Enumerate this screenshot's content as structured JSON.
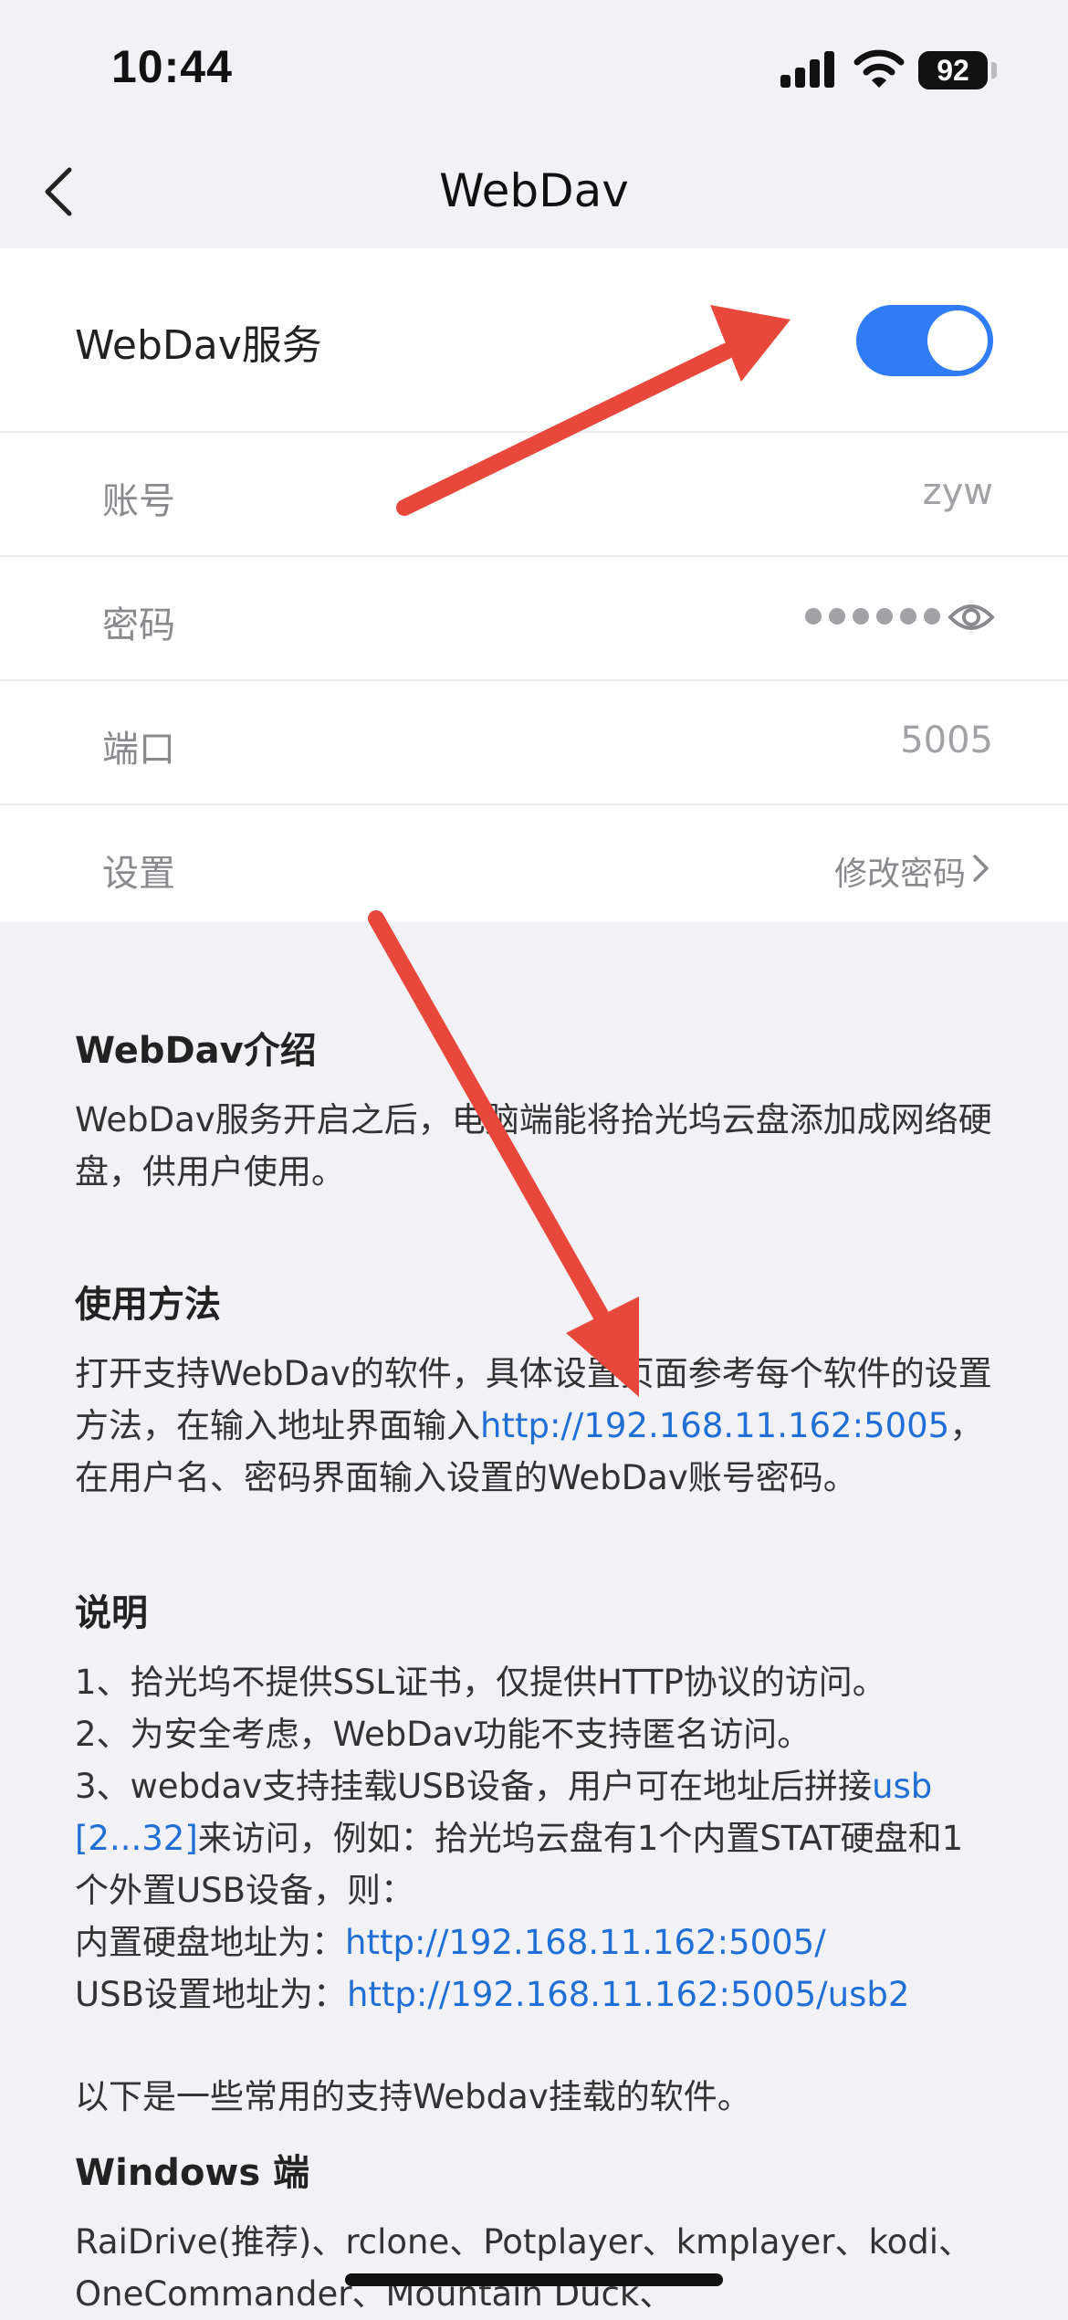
{
  "status_bar": {
    "time": "10:44",
    "battery": "92"
  },
  "nav": {
    "title": "WebDav"
  },
  "service": {
    "label": "WebDav服务",
    "enabled": true
  },
  "fields": {
    "account": {
      "label": "账号",
      "value": "zyw"
    },
    "password": {
      "label": "密码",
      "masked_length": 6
    },
    "port": {
      "label": "端口",
      "value": "5005"
    },
    "settings": {
      "label": "设置",
      "value": "修改密码"
    }
  },
  "intro": {
    "heading": "WebDav介绍",
    "text": "WebDav服务开启之后，电脑端能将拾光坞云盘添加成网络硬盘，供用户使用。"
  },
  "usage": {
    "heading": "使用方法",
    "text_before": "打开支持WebDav的软件，具体设置页面参考每个软件的设置方法，在输入地址界面输入",
    "url": "http://192.168.11.162:5005",
    "text_after": "，在用户名、密码界面输入设置的WebDav账号密码。"
  },
  "notes": {
    "heading": "说明",
    "item1": "1、拾光坞不提供SSL证书，仅提供HTTP协议的访问。",
    "item2": "2、为安全考虑，WebDav功能不支持匿名访问。",
    "item3_before": "3、webdav支持挂载USB设备，用户可在地址后拼接",
    "item3_link": "usb[2...32]",
    "item3_after": "来访问，例如：拾光坞云盘有1个内置STAT硬盘和1个外置USB设备，则：",
    "internal_label": "内置硬盘地址为：",
    "internal_url": "http://192.168.11.162:5005/",
    "usb_label": "USB设置地址为：",
    "usb_url": "http://192.168.11.162:5005/usb2"
  },
  "software": {
    "intro": "以下是一些常用的支持Webdav挂载的软件。",
    "windows_heading": "Windows 端",
    "windows_list": "RaiDrive(推荐)、rclone、Potplayer、kmplayer、kodi、OneCommander、Mountain Duck、"
  },
  "colors": {
    "accent": "#2f7cf6",
    "link": "#1f6fd6",
    "annotation_arrow": "#e8483b"
  }
}
